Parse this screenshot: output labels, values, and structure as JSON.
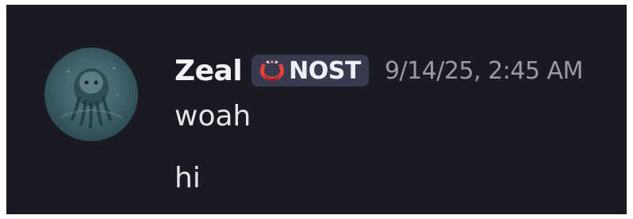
{
  "message_group": {
    "author": {
      "name": "Zeal",
      "avatar_icon": "cthulhu-avatar-icon"
    },
    "server_tag": {
      "icon": "red-ring-badge-icon",
      "label": "NOST",
      "icon_color": "#e8403a"
    },
    "timestamp": "9/14/25, 2:45 AM",
    "messages": [
      {
        "text": "woah"
      },
      {
        "text": "hi"
      }
    ]
  },
  "theme": {
    "background": "#1a1a23",
    "tag_background": "#3a3a4e",
    "name_color": "#f2f2f5",
    "timestamp_color": "#9a9aa8",
    "message_color": "#e6e6ea"
  }
}
